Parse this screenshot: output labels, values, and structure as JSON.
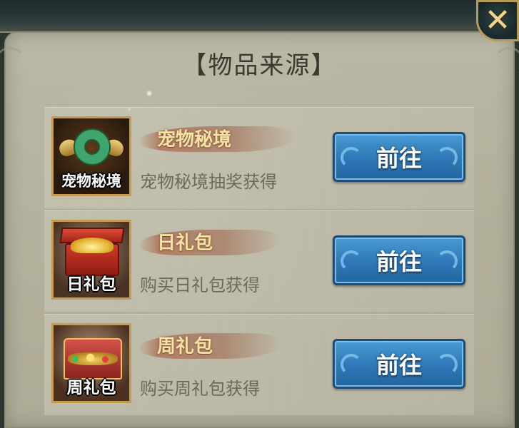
{
  "dialog": {
    "title": "【物品来源】",
    "close_label": "✕"
  },
  "sources": [
    {
      "icon_label": "宠物秘境",
      "name": "宠物秘境",
      "description": "宠物秘境抽奖获得",
      "button_label": "前往",
      "icon": "pet-realm-icon"
    },
    {
      "icon_label": "日礼包",
      "name": "日礼包",
      "description": "购买日礼包获得",
      "button_label": "前往",
      "icon": "daily-gift-pack-icon"
    },
    {
      "icon_label": "周礼包",
      "name": "周礼包",
      "description": "购买周礼包获得",
      "button_label": "前往",
      "icon": "weekly-gift-pack-icon"
    }
  ],
  "colors": {
    "panel": "#b3b09c",
    "button_blue": "#2d78b6",
    "name_text": "#f6e3a8",
    "icon_border": "#c59b52"
  }
}
